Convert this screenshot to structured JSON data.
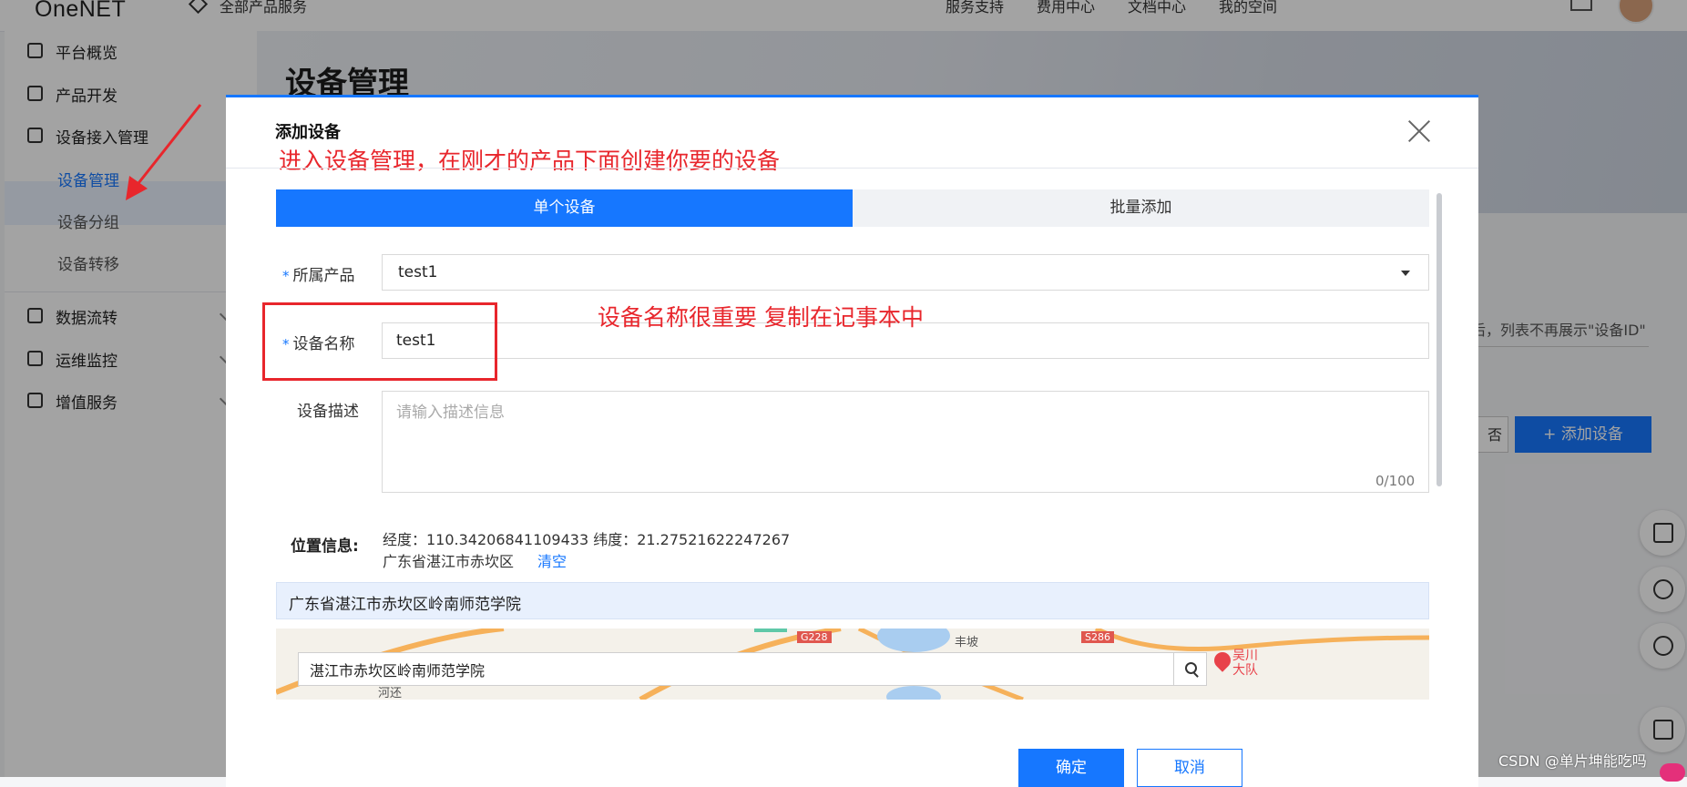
{
  "header": {
    "logo": "OneNET",
    "breadcrumb": "全部产品服务",
    "nav": [
      "服务支持",
      "费用中心",
      "文档中心",
      "我的空间"
    ]
  },
  "sidebar": {
    "items": [
      {
        "label": "平台概览",
        "icon": "dashboard-icon"
      },
      {
        "label": "产品开发",
        "icon": "box-icon"
      },
      {
        "label": "设备接入管理",
        "icon": "device-icon"
      },
      {
        "label": "数据流转",
        "icon": "flow-icon"
      },
      {
        "label": "运维监控",
        "icon": "monitor-icon"
      },
      {
        "label": "增值服务",
        "icon": "send-icon"
      }
    ],
    "subitems": [
      "设备管理",
      "设备分组",
      "设备转移"
    ]
  },
  "page": {
    "title": "设备管理",
    "hint": "后，列表不再展示\"设备ID\"",
    "partial_button": "否",
    "add_button": "+ 添加设备"
  },
  "modal": {
    "title": "添加设备",
    "annotation1": "进入设备管理，在刚才的产品下面创建你要的设备",
    "annotation2": "设备名称很重要  复制在记事本中",
    "tabs": [
      "单个设备",
      "批量添加"
    ],
    "product_label": "所属产品",
    "product_value": "test1",
    "name_label": "设备名称",
    "name_value": "test1",
    "desc_label": "设备描述",
    "desc_placeholder": "请输入描述信息",
    "desc_counter": "0/100",
    "location_label": "位置信息:",
    "coords": "经度：110.34206841109433   纬度：21.27521622247267",
    "district": "广东省湛江市赤坎区",
    "clear": "清空",
    "address": "广东省湛江市赤坎区岭南师范学院",
    "map_search_value": "湛江市赤坎区岭南师范学院",
    "map_labels": [
      "G228",
      "丰坡",
      "S286",
      "河还",
      "吴川",
      "大队"
    ],
    "confirm": "确定",
    "cancel": "取消"
  },
  "watermark": "CSDN @单片坤能吃吗"
}
